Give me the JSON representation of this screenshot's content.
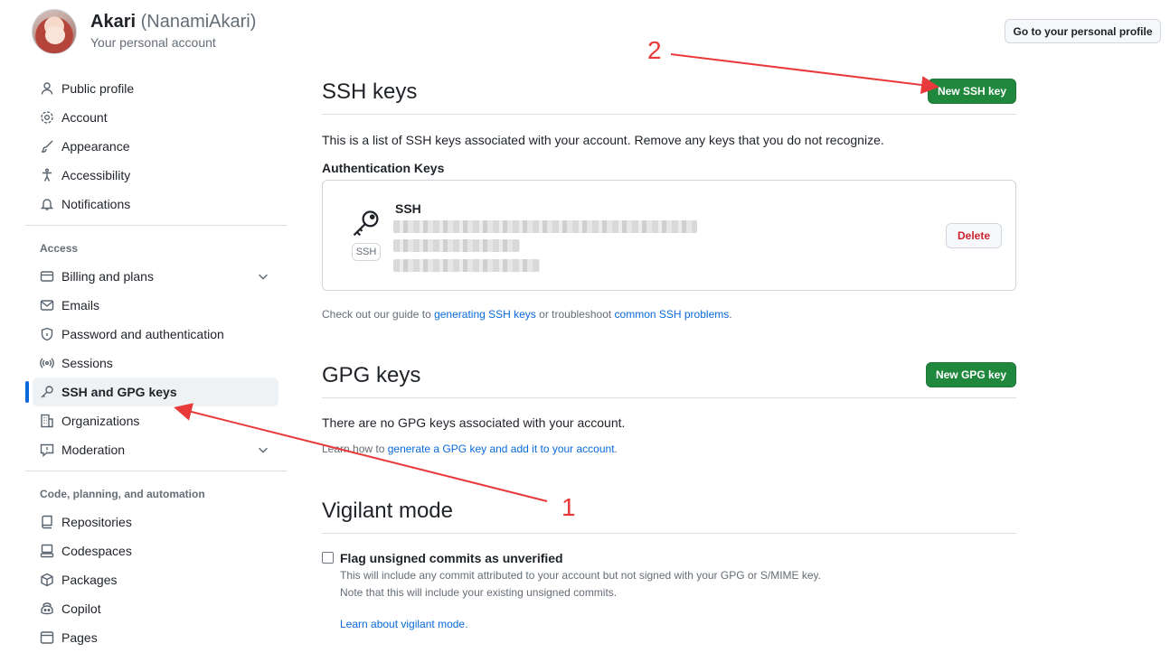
{
  "header": {
    "display_name": "Akari",
    "login": "(NanamiAkari)",
    "subtitle": "Your personal account",
    "profile_button": "Go to your personal profile"
  },
  "sidebar": {
    "items_top": [
      {
        "label": "Public profile",
        "icon": "person-icon"
      },
      {
        "label": "Account",
        "icon": "gear-icon"
      },
      {
        "label": "Appearance",
        "icon": "paintbrush-icon"
      },
      {
        "label": "Accessibility",
        "icon": "accessibility-icon"
      },
      {
        "label": "Notifications",
        "icon": "bell-icon"
      }
    ],
    "access_label": "Access",
    "items_access": [
      {
        "label": "Billing and plans",
        "icon": "credit-card-icon"
      },
      {
        "label": "Emails",
        "icon": "mail-icon"
      },
      {
        "label": "Password and authentication",
        "icon": "shield-lock-icon"
      },
      {
        "label": "Sessions",
        "icon": "broadcast-icon"
      },
      {
        "label": "SSH and GPG keys",
        "icon": "key-icon"
      },
      {
        "label": "Organizations",
        "icon": "organization-icon"
      },
      {
        "label": "Moderation",
        "icon": "report-icon"
      }
    ],
    "code_label": "Code, planning, and automation",
    "items_code": [
      {
        "label": "Repositories",
        "icon": "repo-icon"
      },
      {
        "label": "Codespaces",
        "icon": "codespaces-icon"
      },
      {
        "label": "Packages",
        "icon": "package-icon"
      },
      {
        "label": "Copilot",
        "icon": "copilot-icon"
      },
      {
        "label": "Pages",
        "icon": "browser-icon"
      }
    ]
  },
  "ssh": {
    "title": "SSH keys",
    "new_button": "New SSH key",
    "description": "This is a list of SSH keys associated with your account. Remove any keys that you do not recognize.",
    "auth_keys_heading": "Authentication Keys",
    "key_title": "SSH",
    "key_badge": "SSH",
    "delete_button": "Delete",
    "guide_prefix": "Check out our guide to ",
    "guide_link1": "generating SSH keys",
    "guide_middle": " or troubleshoot ",
    "guide_link2": "common SSH problems",
    "guide_suffix": "."
  },
  "gpg": {
    "title": "GPG keys",
    "new_button": "New GPG key",
    "empty_text": "There are no GPG keys associated with your account.",
    "learn_prefix": "Learn how to ",
    "learn_link": "generate a GPG key and add it to your account",
    "learn_suffix": "."
  },
  "vigilant": {
    "title": "Vigilant mode",
    "checkbox_label": "Flag unsigned commits as unverified",
    "note1": "This will include any commit attributed to your account but not signed with your GPG or S/MIME key.",
    "note2": "Note that this will include your existing unsigned commits.",
    "learn_link": "Learn about vigilant mode."
  },
  "annotations": {
    "marker1": "1",
    "marker2": "2",
    "color": "#e83a3a"
  }
}
